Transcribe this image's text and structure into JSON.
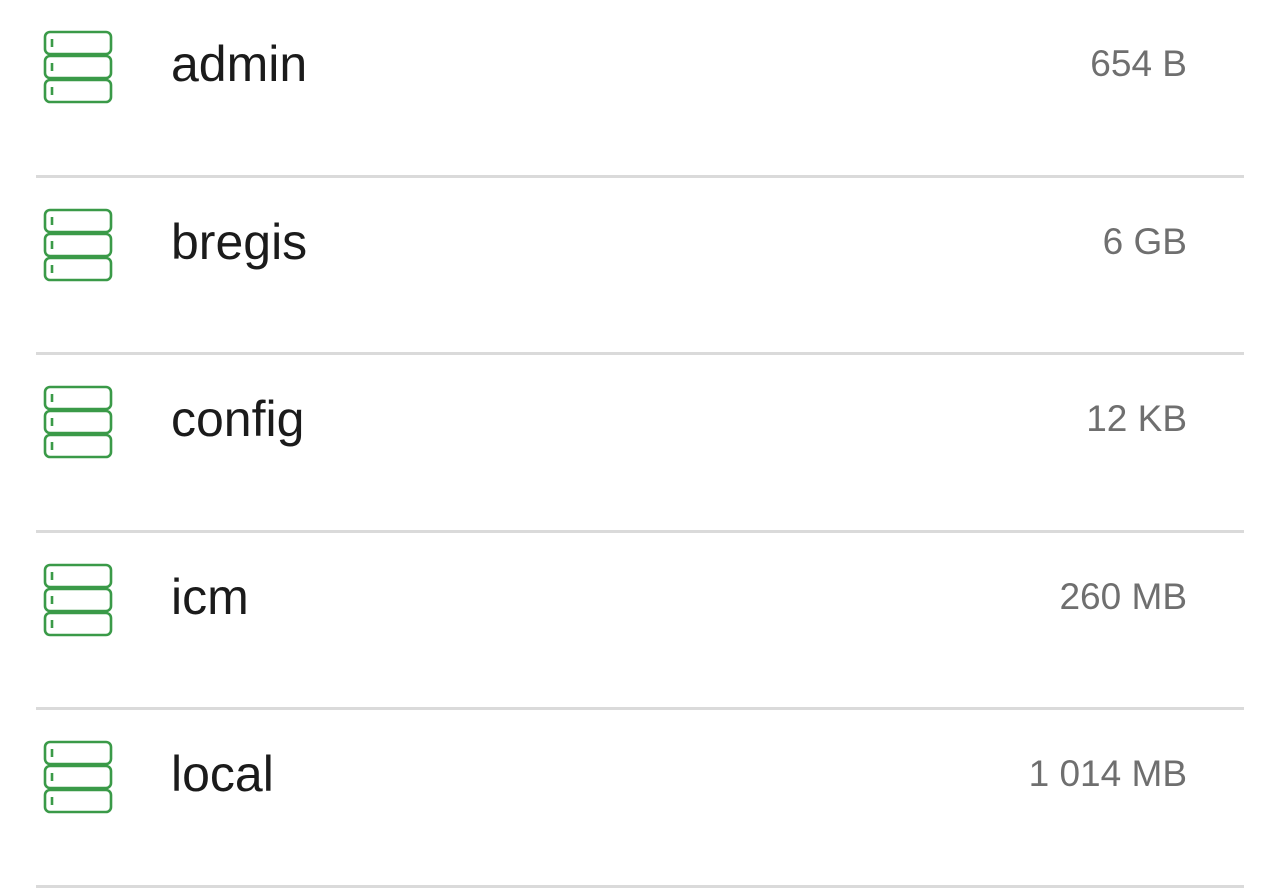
{
  "theme": {
    "icon_color": "#3a9a48",
    "name_color": "#1b1b1b",
    "size_color": "#6f6f6f",
    "divider_color": "#dadada"
  },
  "databases": [
    {
      "icon": "database-icon",
      "name": "admin",
      "size": "654 B"
    },
    {
      "icon": "database-icon",
      "name": "bregis",
      "size": "6 GB"
    },
    {
      "icon": "database-icon",
      "name": "config",
      "size": "12 KB"
    },
    {
      "icon": "database-icon",
      "name": "icm",
      "size": "260 MB"
    },
    {
      "icon": "database-icon",
      "name": "local",
      "size": "1 014 MB"
    }
  ]
}
